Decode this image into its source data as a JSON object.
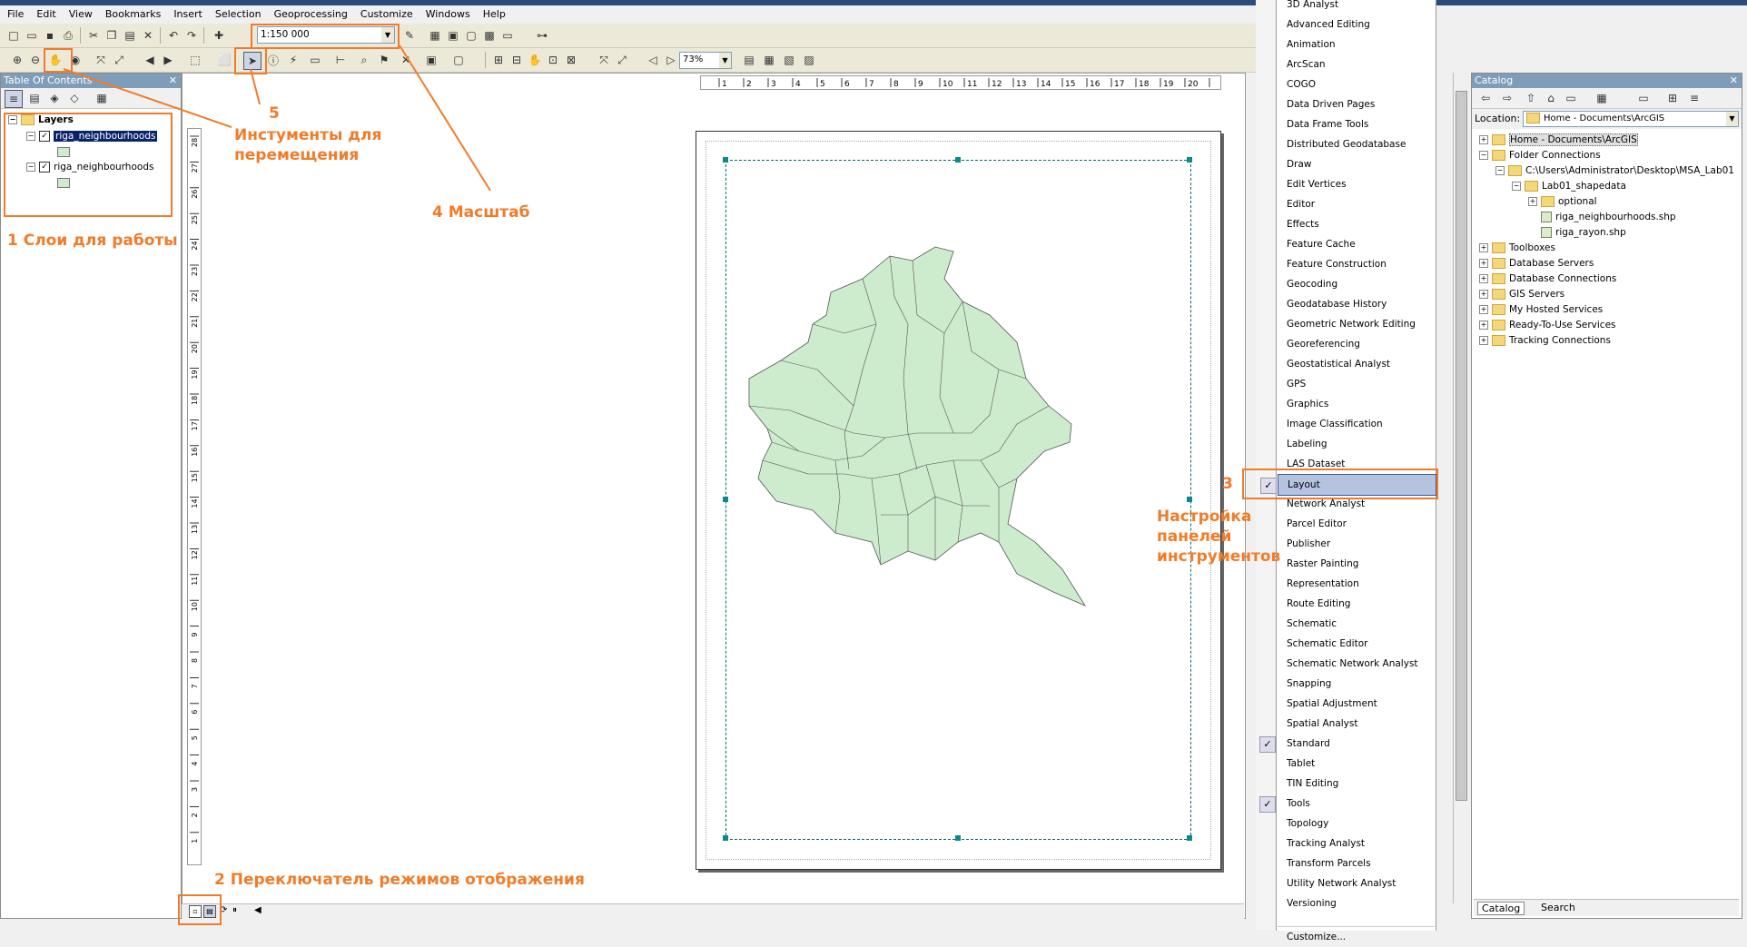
{
  "menubar": [
    "File",
    "Edit",
    "View",
    "Bookmarks",
    "Insert",
    "Selection",
    "Geoprocessing",
    "Customize",
    "Windows",
    "Help"
  ],
  "toolbar": {
    "scale_value": "1:150 000",
    "zoom_value": "73%"
  },
  "toc": {
    "title": "Table Of Contents",
    "root": "Layers",
    "layers": [
      "riga_neighbourhoods",
      "riga_neighbourhoods"
    ]
  },
  "catalog": {
    "title": "Catalog",
    "location_label": "Location:",
    "location_value": "Home - Documents\\ArcGIS",
    "items": [
      {
        "label": "Home - Documents\\ArcGIS",
        "level": 0,
        "pm": "+"
      },
      {
        "label": "Folder Connections",
        "level": 0,
        "pm": "-"
      },
      {
        "label": "C:\\Users\\Administrator\\Desktop\\MSA_Lab01",
        "level": 1,
        "pm": "-"
      },
      {
        "label": "Lab01_shapedata",
        "level": 2,
        "pm": "-"
      },
      {
        "label": "optional",
        "level": 3,
        "pm": "+"
      },
      {
        "label": "riga_neighbourhoods.shp",
        "level": 3,
        "pm": ""
      },
      {
        "label": "riga_rayon.shp",
        "level": 3,
        "pm": ""
      },
      {
        "label": "Toolboxes",
        "level": 0,
        "pm": "+"
      },
      {
        "label": "Database Servers",
        "level": 0,
        "pm": "+"
      },
      {
        "label": "Database Connections",
        "level": 0,
        "pm": "+"
      },
      {
        "label": "GIS Servers",
        "level": 0,
        "pm": "+"
      },
      {
        "label": "My Hosted Services",
        "level": 0,
        "pm": "+"
      },
      {
        "label": "Ready-To-Use Services",
        "level": 0,
        "pm": "+"
      },
      {
        "label": "Tracking Connections",
        "level": 0,
        "pm": "+"
      }
    ],
    "tabs": [
      "Catalog",
      "Search"
    ]
  },
  "context_menu": {
    "items": [
      {
        "label": "3D Analyst",
        "checked": false
      },
      {
        "label": "Advanced Editing",
        "checked": false
      },
      {
        "label": "Animation",
        "checked": false
      },
      {
        "label": "ArcScan",
        "checked": false
      },
      {
        "label": "COGO",
        "checked": false
      },
      {
        "label": "Data Driven Pages",
        "checked": false
      },
      {
        "label": "Data Frame Tools",
        "checked": false
      },
      {
        "label": "Distributed Geodatabase",
        "checked": false
      },
      {
        "label": "Draw",
        "checked": false
      },
      {
        "label": "Edit Vertices",
        "checked": false
      },
      {
        "label": "Editor",
        "checked": false
      },
      {
        "label": "Effects",
        "checked": false
      },
      {
        "label": "Feature Cache",
        "checked": false
      },
      {
        "label": "Feature Construction",
        "checked": false
      },
      {
        "label": "Geocoding",
        "checked": false
      },
      {
        "label": "Geodatabase History",
        "checked": false
      },
      {
        "label": "Geometric Network Editing",
        "checked": false
      },
      {
        "label": "Georeferencing",
        "checked": false
      },
      {
        "label": "Geostatistical Analyst",
        "checked": false
      },
      {
        "label": "GPS",
        "checked": false
      },
      {
        "label": "Graphics",
        "checked": false
      },
      {
        "label": "Image Classification",
        "checked": false
      },
      {
        "label": "Labeling",
        "checked": false
      },
      {
        "label": "LAS Dataset",
        "checked": false
      },
      {
        "label": "Layout",
        "checked": true,
        "highlight": true
      },
      {
        "label": "Network Analyst",
        "checked": false
      },
      {
        "label": "Parcel Editor",
        "checked": false
      },
      {
        "label": "Publisher",
        "checked": false
      },
      {
        "label": "Raster Painting",
        "checked": false
      },
      {
        "label": "Representation",
        "checked": false
      },
      {
        "label": "Route Editing",
        "checked": false
      },
      {
        "label": "Schematic",
        "checked": false
      },
      {
        "label": "Schematic Editor",
        "checked": false
      },
      {
        "label": "Schematic Network Analyst",
        "checked": false
      },
      {
        "label": "Snapping",
        "checked": false
      },
      {
        "label": "Spatial Adjustment",
        "checked": false
      },
      {
        "label": "Spatial Analyst",
        "checked": false
      },
      {
        "label": "Standard",
        "checked": true
      },
      {
        "label": "Tablet",
        "checked": false
      },
      {
        "label": "TIN Editing",
        "checked": false
      },
      {
        "label": "Tools",
        "checked": true
      },
      {
        "label": "Topology",
        "checked": false
      },
      {
        "label": "Tracking Analyst",
        "checked": false
      },
      {
        "label": "Transform Parcels",
        "checked": false
      },
      {
        "label": "Utility Network Analyst",
        "checked": false
      },
      {
        "label": "Versioning",
        "checked": false
      },
      {
        "label": "Customize...",
        "checked": false
      }
    ]
  },
  "annotations": {
    "a1": "1 Слои для работы",
    "a2": "2 Переключатель режимов отображения",
    "a3_num": "3",
    "a3_text": "Настройка\nпанелей\nинструментов",
    "a4": "4  Масштаб",
    "a5_num": "5",
    "a5_text": "Инстументы для\nперемещения"
  },
  "ruler": {
    "h_ticks": [
      "1",
      "2",
      "3",
      "4",
      "5",
      "6",
      "7",
      "8",
      "9",
      "10",
      "11",
      "12",
      "13",
      "14",
      "15",
      "16",
      "17",
      "18",
      "19",
      "20"
    ],
    "v_ticks": [
      "28",
      "27",
      "26",
      "25",
      "24",
      "23",
      "22",
      "21",
      "20",
      "19",
      "18",
      "17",
      "16",
      "15",
      "14",
      "13",
      "12",
      "11",
      "10",
      "9",
      "8",
      "7",
      "6",
      "5",
      "4",
      "3",
      "2",
      "1"
    ]
  },
  "colors": {
    "accent": "#f07c2a",
    "map_fill": "#cdeccd",
    "highlight": "#b4c4e0"
  }
}
